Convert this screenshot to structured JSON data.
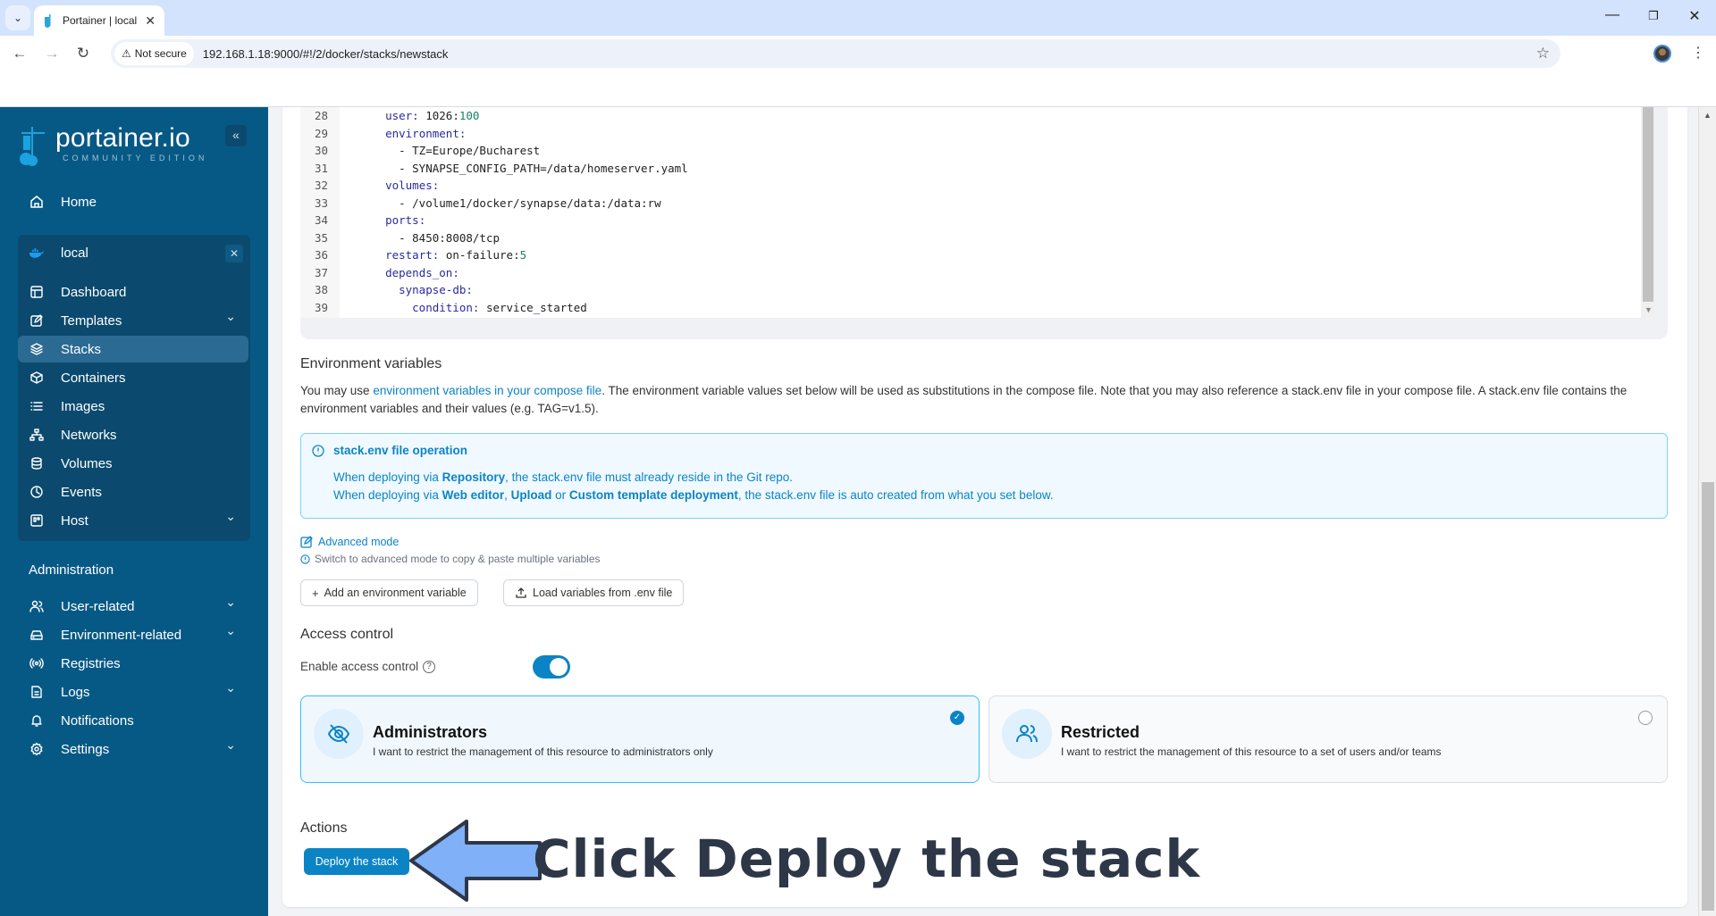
{
  "browser": {
    "tab_title": "Portainer | local",
    "tab_close": "✕",
    "tab_list_icon": "⌄",
    "security_label": "Not secure",
    "url": "192.168.1.18:9000/#!/2/docker/stacks/newstack",
    "window_controls": {
      "minimize": "—",
      "restore": "❐",
      "close": "✕"
    }
  },
  "sidebar": {
    "brand": "portainer.io",
    "edition": "COMMUNITY EDITION",
    "collapse": "«",
    "home": "Home",
    "environment": {
      "name": "local",
      "close": "✕"
    },
    "env_items": [
      {
        "label": "Dashboard",
        "icon": "dashboard-icon"
      },
      {
        "label": "Templates",
        "icon": "edit-icon",
        "expandable": true
      },
      {
        "label": "Stacks",
        "icon": "layers-icon",
        "active": true
      },
      {
        "label": "Containers",
        "icon": "box-icon"
      },
      {
        "label": "Images",
        "icon": "list-icon"
      },
      {
        "label": "Networks",
        "icon": "network-icon"
      },
      {
        "label": "Volumes",
        "icon": "database-icon"
      },
      {
        "label": "Events",
        "icon": "clock-icon"
      },
      {
        "label": "Host",
        "icon": "host-icon",
        "expandable": true
      }
    ],
    "admin_title": "Administration",
    "admin_items": [
      {
        "label": "User-related",
        "icon": "users-icon",
        "expandable": true
      },
      {
        "label": "Environment-related",
        "icon": "drive-icon",
        "expandable": true
      },
      {
        "label": "Registries",
        "icon": "radio-icon"
      },
      {
        "label": "Logs",
        "icon": "file-icon",
        "expandable": true
      },
      {
        "label": "Notifications",
        "icon": "bell-icon"
      },
      {
        "label": "Settings",
        "icon": "gear-icon",
        "expandable": true
      }
    ]
  },
  "editor": {
    "lines": [
      {
        "n": "28",
        "indent": "  ",
        "key": "user",
        "sep": ": ",
        "val": "1026:",
        "num": "100"
      },
      {
        "n": "29",
        "indent": "  ",
        "key": "environment",
        "sep": ":",
        "val": "",
        "num": ""
      },
      {
        "n": "30",
        "indent": "    ",
        "key": "",
        "sep": "",
        "val": "- TZ=Europe/Bucharest",
        "num": ""
      },
      {
        "n": "31",
        "indent": "    ",
        "key": "",
        "sep": "",
        "val": "- SYNAPSE_CONFIG_PATH=/data/homeserver.yaml",
        "num": ""
      },
      {
        "n": "32",
        "indent": "  ",
        "key": "volumes",
        "sep": ":",
        "val": "",
        "num": ""
      },
      {
        "n": "33",
        "indent": "    ",
        "key": "",
        "sep": "",
        "val": "- /volume1/docker/synapse/data:/data:rw",
        "num": ""
      },
      {
        "n": "34",
        "indent": "  ",
        "key": "ports",
        "sep": ":",
        "val": "",
        "num": ""
      },
      {
        "n": "35",
        "indent": "    ",
        "key": "",
        "sep": "",
        "val": "- 8450:8008/tcp",
        "num": ""
      },
      {
        "n": "36",
        "indent": "  ",
        "key": "restart",
        "sep": ": ",
        "val": "on-failure:",
        "num": "5"
      },
      {
        "n": "37",
        "indent": "  ",
        "key": "depends_on",
        "sep": ":",
        "val": "",
        "num": ""
      },
      {
        "n": "38",
        "indent": "    ",
        "key": "synapse-db",
        "sep": ":",
        "val": "",
        "num": ""
      },
      {
        "n": "39",
        "indent": "      ",
        "key": "condition",
        "sep": ": ",
        "val": "service_started",
        "num": ""
      }
    ]
  },
  "env_vars": {
    "title": "Environment variables",
    "intro_prefix": "You may use ",
    "intro_link": "environment variables in your compose file",
    "intro_suffix": ". The environment variable values set below will be used as substitutions in the compose file. Note that you may also reference a stack.env file in your compose file. A stack.env file contains the environment variables and their values (e.g. TAG=v1.5).",
    "alert": {
      "title": "stack.env file operation",
      "line1_a": "When deploying via ",
      "line1_b": "Repository",
      "line1_c": ", the stack.env file must already reside in the Git repo.",
      "line2_a": "When deploying via ",
      "line2_b": "Web editor",
      "line2_c": ", ",
      "line2_d": "Upload",
      "line2_e": " or ",
      "line2_f": "Custom template deployment",
      "line2_g": ", the stack.env file is auto created from what you set below."
    },
    "advanced_mode": "Advanced mode",
    "advanced_hint": "Switch to advanced mode to copy & paste multiple variables",
    "add_button": "Add an environment variable",
    "load_button": "Load variables from .env file"
  },
  "access_control": {
    "title": "Access control",
    "enable_label": "Enable access control",
    "enabled": true,
    "options": [
      {
        "title": "Administrators",
        "description": "I want to restrict the management of this resource to administrators only",
        "selected": true
      },
      {
        "title": "Restricted",
        "description": "I want to restrict the management of this resource to a set of users and/or teams",
        "selected": false
      }
    ]
  },
  "actions": {
    "title": "Actions",
    "deploy_button": "Deploy the stack"
  },
  "annotation": {
    "text": "Click Deploy the stack"
  },
  "colors": {
    "sidebar_bg": "#075985",
    "accent": "#0b84c6",
    "annotation_arrow": "#7fb0f8",
    "annotation_text": "#2d3748"
  }
}
